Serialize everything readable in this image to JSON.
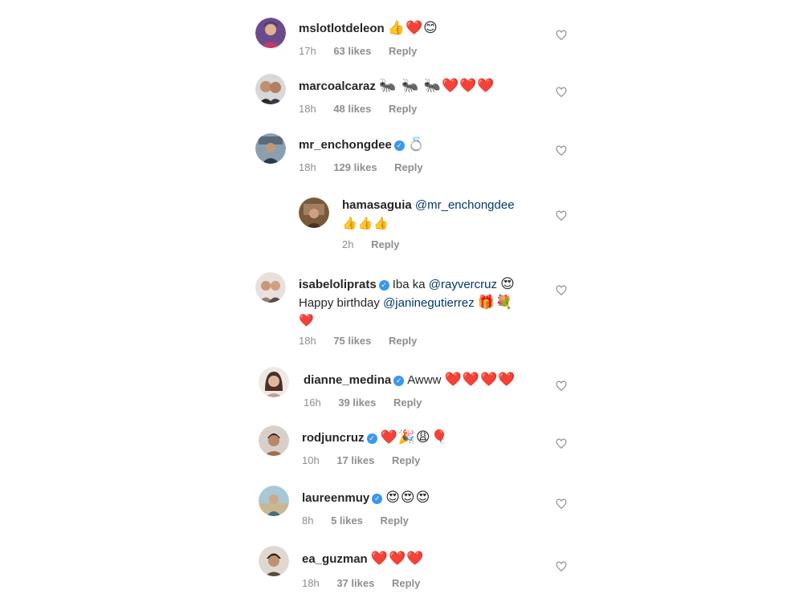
{
  "comments": [
    {
      "user": "mslotlotdeleon",
      "verified": false,
      "text": "",
      "emoji": "👍❤️😊",
      "time": "17h",
      "likes": "63 likes",
      "reply": "Reply",
      "avatar_color": "#6a4c8c"
    },
    {
      "user": "marcoalcaraz",
      "verified": false,
      "text": "",
      "emoji": "🐜 🐜 🐜❤️❤️❤️",
      "time": "18h",
      "likes": "48 likes",
      "reply": "Reply",
      "avatar_color": "#3a3a3a"
    },
    {
      "user": "mr_enchongdee",
      "verified": true,
      "text": "",
      "emoji": "💍",
      "time": "18h",
      "likes": "129 likes",
      "reply": "Reply",
      "avatar_color": "#4a5a66"
    },
    {
      "user": "hamasaguia",
      "verified": false,
      "mention": "@mr_enchongdee",
      "line2": "👍👍👍",
      "time": "2h",
      "likes": "",
      "reply": "Reply",
      "avatar_color": "#7a5a3a"
    },
    {
      "user": "isabeloliprats",
      "verified": true,
      "text": "Iba ka",
      "mention": "@rayvercruz",
      "emoji": "😍",
      "line2_text": "Happy birthday",
      "line2_mention": "@janinegutierrez",
      "line2_emoji": "🎁💐",
      "line3": "❤️",
      "time": "18h",
      "likes": "75 likes",
      "reply": "Reply",
      "avatar_color": "#9a8070"
    },
    {
      "user": "dianne_medina",
      "verified": true,
      "text": "Awww",
      "emoji": "❤️❤️❤️❤️",
      "time": "16h",
      "likes": "39 likes",
      "reply": "Reply",
      "avatar_color": "#a08070"
    },
    {
      "user": "rodjuncruz",
      "verified": true,
      "text": "",
      "emoji": "❤️🎉😩🎈",
      "time": "10h",
      "likes": "17 likes",
      "reply": "Reply",
      "avatar_color": "#6a5040"
    },
    {
      "user": "laureenmuy",
      "verified": true,
      "text": "",
      "emoji": "😍😍😍",
      "time": "8h",
      "likes": "5 likes",
      "reply": "Reply",
      "avatar_color": "#5a7a8a"
    },
    {
      "user": "ea_guzman",
      "verified": false,
      "text": "",
      "emoji": "❤️❤️❤️",
      "time": "18h",
      "likes": "37 likes",
      "reply": "Reply",
      "avatar_color": "#5a4a3a"
    }
  ],
  "icons": {
    "heart": "heart-outline-icon",
    "verified": "verified-badge-icon"
  }
}
